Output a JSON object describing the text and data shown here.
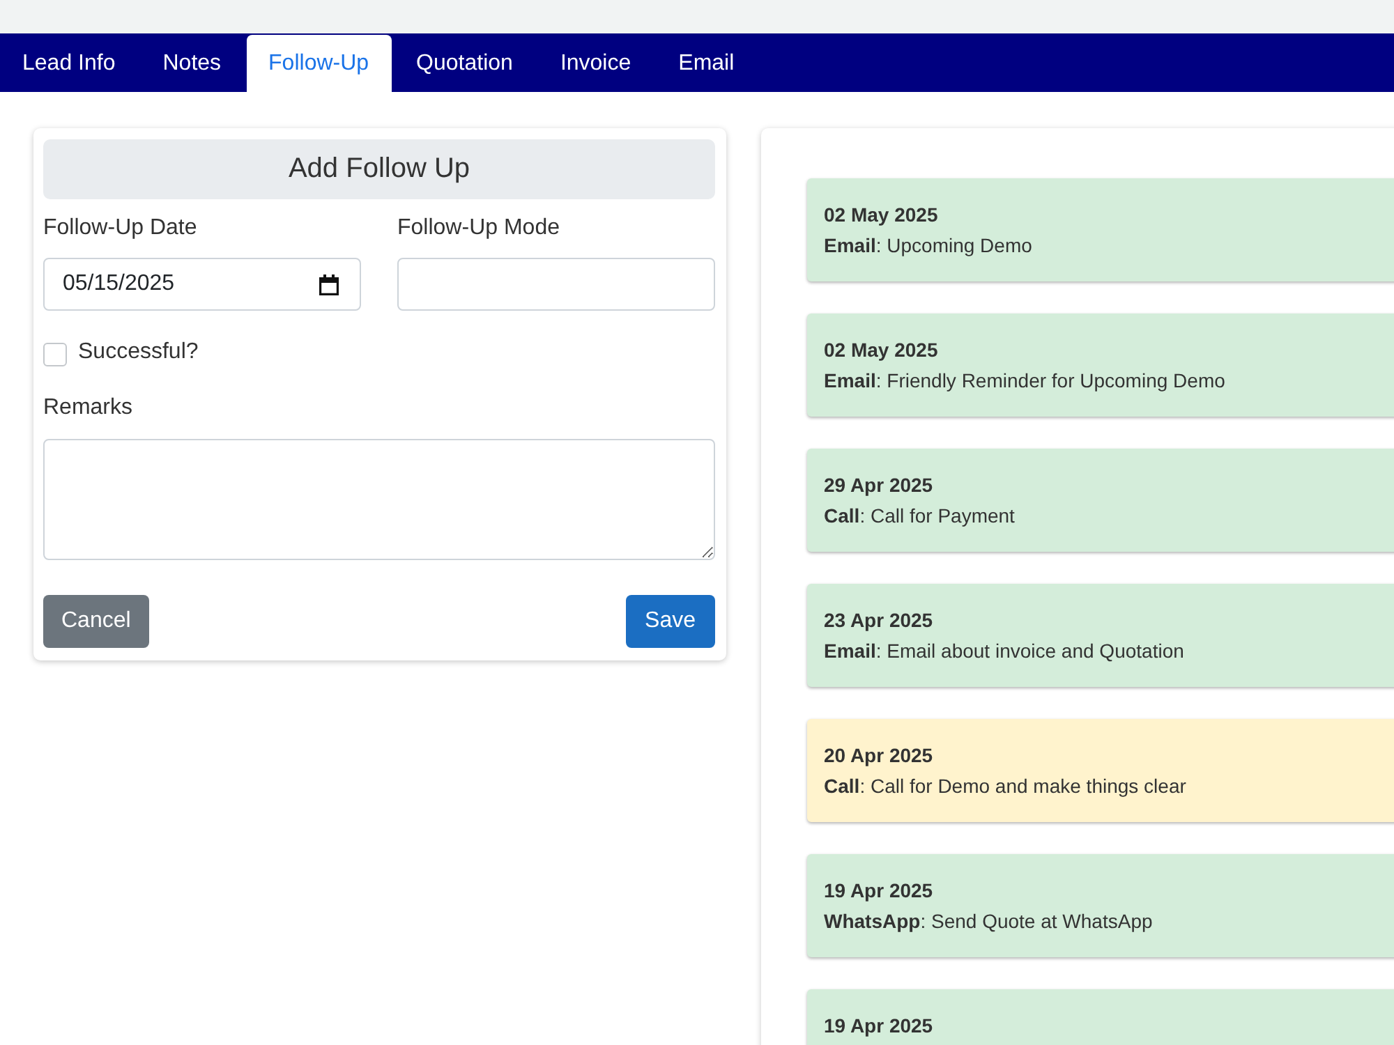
{
  "tabs": [
    {
      "label": "Lead Info",
      "selected": false
    },
    {
      "label": "Notes",
      "selected": false
    },
    {
      "label": "Follow-Up",
      "selected": true
    },
    {
      "label": "Quotation",
      "selected": false
    },
    {
      "label": "Invoice",
      "selected": false
    },
    {
      "label": "Email",
      "selected": false
    }
  ],
  "form": {
    "title": "Add Follow Up",
    "date_label": "Follow-Up Date",
    "date_value": "05/15/2025",
    "mode_label": "Follow-Up Mode",
    "successful": {
      "label": "Successful?",
      "checked": false
    },
    "remarks_label": "Remarks",
    "buttons": [
      {
        "label": "Cancel",
        "kind": "secondary"
      },
      {
        "label": "Save",
        "kind": "primary"
      }
    ]
  },
  "followups": [
    {
      "date": "02 May 2025",
      "text": "**Email**: Upcoming Demo",
      "color": "#d4edda"
    },
    {
      "date": "02 May 2025",
      "text": "**Email**: Friendly Reminder for Upcoming Demo",
      "color": "#d4edda"
    },
    {
      "date": "29 Apr 2025",
      "text": "**Call**: Call for Payment",
      "color": "#d4edda"
    },
    {
      "date": "23 Apr 2025",
      "text": "**Email**: Email about invoice and Quotation",
      "color": "#d4edda"
    },
    {
      "date": "20 Apr 2025",
      "text": "**Call**: Call for Demo and make things clear",
      "color": "#fff3cd"
    },
    {
      "date": "19 Apr 2025",
      "text": "**WhatsApp**: Send Quote at WhatsApp",
      "color": "#d4edda"
    },
    {
      "date": "19 Apr 2025",
      "color": "#d4edda"
    }
  ]
}
